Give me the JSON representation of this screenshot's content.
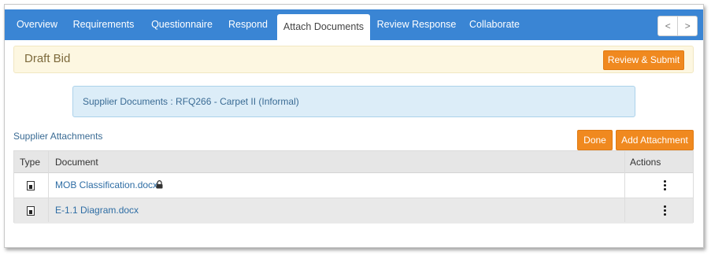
{
  "tabs": [
    {
      "label": "Overview",
      "active": false
    },
    {
      "label": "Requirements",
      "active": false
    },
    {
      "label": "Questionnaire",
      "active": false
    },
    {
      "label": "Respond",
      "active": false
    },
    {
      "label": "Attach Documents",
      "active": true
    },
    {
      "label": "Review Response",
      "active": false
    },
    {
      "label": "Collaborate",
      "active": false
    }
  ],
  "nav": {
    "prev": "<",
    "next": ">"
  },
  "draft": {
    "title": "Draft Bid",
    "review_submit": "Review & Submit"
  },
  "info": {
    "text": "Supplier Documents : RFQ266 - Carpet II (Informal)"
  },
  "attachments": {
    "label": "Supplier Attachments",
    "done": "Done",
    "add": "Add Attachment",
    "columns": {
      "type": "Type",
      "document": "Document",
      "actions": "Actions"
    },
    "rows": [
      {
        "type_icon": "document-icon",
        "name": "MOB Classification.docx",
        "locked": true
      },
      {
        "type_icon": "document-icon",
        "name": "E-1.1 Diagram.docx",
        "locked": false
      }
    ]
  },
  "colors": {
    "tabbar": "#3a85d4",
    "accent_orange": "#f0891f",
    "draft_bg": "#fdf7e1",
    "info_bg": "#dcedf8",
    "link": "#2e6da4"
  }
}
